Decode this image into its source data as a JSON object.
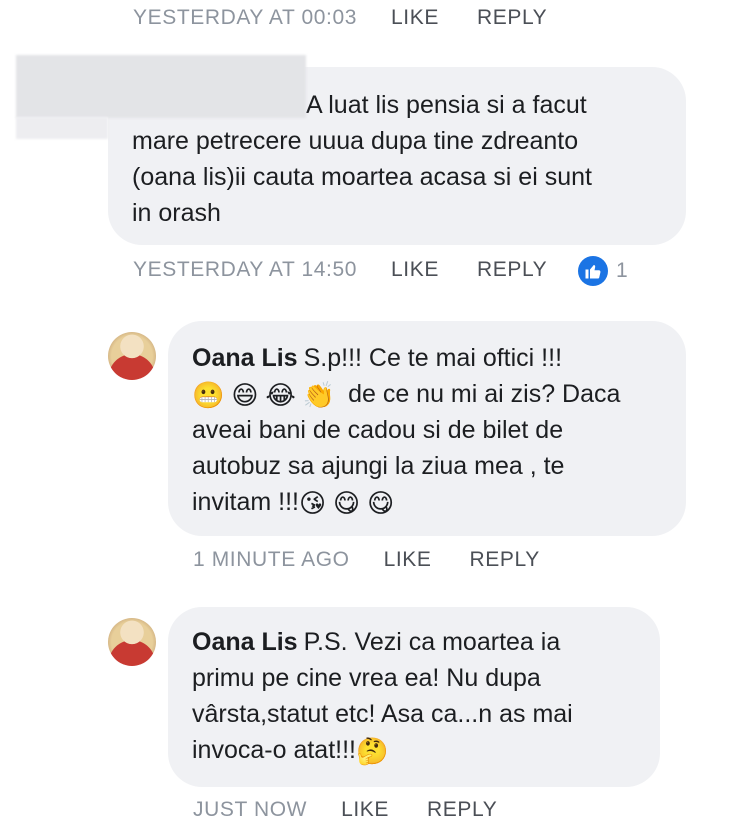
{
  "comments": [
    {
      "meta": {
        "time": "YESTERDAY AT 00:03",
        "like": "LIKE",
        "reply": "REPLY"
      }
    },
    {
      "author": "",
      "lines": [
        "A luat lis pensia si a facut",
        "mare petrecere uuua dupa tine zdreanto",
        "(oana lis)ii cauta moartea acasa si ei sunt",
        "in orash"
      ],
      "meta": {
        "time": "YESTERDAY AT 14:50",
        "like": "LIKE",
        "reply": "REPLY",
        "reaction_count": "1"
      }
    },
    {
      "author": "Oana Lis",
      "text_1": "S.p!!! Ce te mai oftici !!!",
      "emojis_line2": [
        "😬",
        "😄",
        "😂",
        "👏"
      ],
      "text_2": "de ce nu mi ai zis? Daca",
      "text_3": "aveai bani de cadou si de bilet de",
      "text_4": "autobuz sa ajungi la ziua mea , te",
      "text_5": "invitam !!!",
      "emojis_line5": [
        "😘",
        "😋",
        "😋"
      ],
      "meta": {
        "time": "1 MINUTE AGO",
        "like": "LIKE",
        "reply": "REPLY"
      }
    },
    {
      "author": "Oana Lis",
      "text_1": "P.S. Vezi ca moartea ia",
      "text_2": "primu pe cine vrea ea! Nu dupa",
      "text_3": "vârsta,statut etc! Asa ca...n as mai",
      "text_4": "invoca-o atat!!!",
      "emoji_end": "🤔",
      "meta": {
        "time": "JUST NOW",
        "like": "LIKE",
        "reply": "REPLY"
      }
    }
  ],
  "icons": {
    "like_reaction": "thumbs-up-icon",
    "avatar": "profile-photo"
  },
  "colors": {
    "bubble": "#f0f1f4",
    "meta": "#8d949e",
    "action": "#4b4f56",
    "like_blue": "#1b74e4"
  }
}
